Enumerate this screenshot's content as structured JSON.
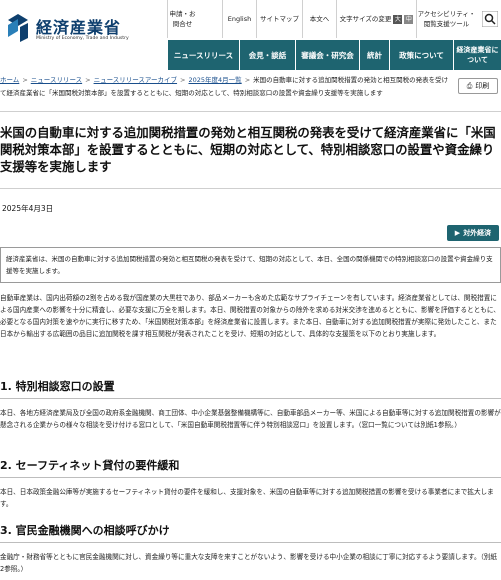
{
  "header": {
    "logo_jp": "経済産業省",
    "logo_en": "Ministry of Economy, Trade and Industry",
    "util": {
      "inquiry": "申請・お問合せ",
      "english": "English",
      "sitemap": "サイトマップ",
      "text_size": "本文へ",
      "size_label": "文字サイズの変更",
      "size_large": "大",
      "size_medium": "中",
      "size_small": "小",
      "accessibility": "アクセシビリティ・閲覧支援ツール"
    },
    "nav": {
      "news": "ニュースリリース",
      "press": "会見・談話",
      "council": "審議会・研究会",
      "stats": "統計",
      "policy": "政策について",
      "about": "経済産業省について"
    }
  },
  "breadcrumb": {
    "items": [
      "ホーム",
      "ニュースリリース",
      "ニュースリリースアーカイブ",
      "2025年度4月一覧"
    ],
    "current": "米国の自動車に対する追加関税措置の発効と相互関税の発表を受けて経済産業省に「米国関税対策本部」を設置するとともに、短期の対応として、特別相談窓口の設置や資金繰り支援等を実施します",
    "print": "印刷"
  },
  "article": {
    "title": "米国の自動車に対する追加関税措置の発効と相互関税の発表を受けて経済産業省に「米国関税対策本部」を設置するとともに、短期の対応として、特別相談窓口の設置や資金繰り支援等を実施します",
    "date": "2025年4月3日",
    "tag": "対外経済",
    "summary": "経済産業省は、米国の自動車に対する追加関税措置の発効と相互関税の発表を受けて、短期の対応として、本日、全国の関係機関での特別相談窓口の設置や資金繰り支援等を実施します。",
    "intro": "自動車産業は、国内出荷額の2割を占める我が国産業の大黒柱であり、部品メーカーも含めた広範なサプライチェーンを有しています。経済産業省としては、関税措置による国内産業への影響を十分に精査し、必要な支援に万全を期します。本日、関税措置の対象からの除外を求める対米交渉を進めるとともに、影響を評価するとともに、必要となる国内対策を速やかに実行に移すため、「米国関税対策本部」を経済産業省に設置します。また本日、自動車に対する追加関税措置が実際に発効したこと、また日本から輸出する広範囲の品目に追加関税を課す相互関税が発表されたことを受け、短期の対応として、具体的な支援策を以下のとおり実施します。",
    "sections": [
      {
        "heading": "1. 特別相談窓口の設置",
        "body": "本日、各地方経済産業局及び全国の政府系金融機関、商工団体、中小企業基盤整備機構等に、自動車部品メーカー等、米国による自動車等に対する追加関税措置の影響が懸念される企業からの様々な相談を受け付ける窓口として、「米国自動車関税措置等に伴う特別相談窓口」を設置します。（窓口一覧については別紙1参照。）"
      },
      {
        "heading": "2. セーフティネット貸付の要件緩和",
        "body": "本日、日本政策金融公庫等が実施するセーフティネット貸付の要件を緩和し、支援対象を、米国の自動車等に対する追加関税措置の影響を受ける事業者にまで拡大します。"
      },
      {
        "heading": "3. 官民金融機関への相談呼びかけ",
        "body": "金融庁・財務省等とともに官民金融機関に対し、資金繰り等に重大な支障を来すことがないよう、影響を受ける中小企業の相談に丁寧に対応するよう要請します。（別紙2参照。）"
      }
    ]
  },
  "colors": {
    "brand": "#1e6470",
    "logo": "#0e3f6e",
    "link": "#1a4f8c"
  }
}
